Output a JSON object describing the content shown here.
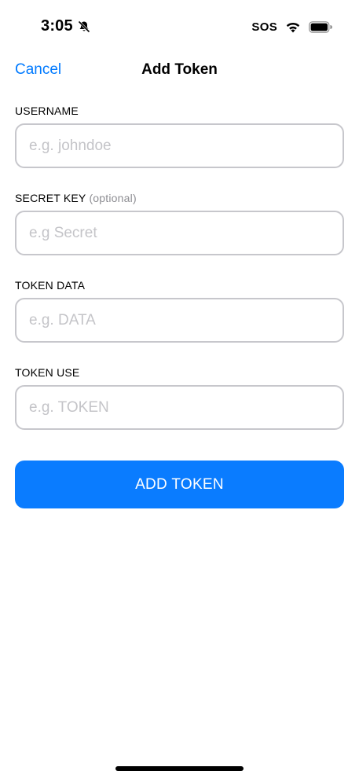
{
  "status_bar": {
    "time": "3:05",
    "carrier_text": "SOS",
    "icons": [
      "bell-slash-icon",
      "wifi-icon",
      "battery-icon"
    ]
  },
  "nav": {
    "cancel_label": "Cancel",
    "title": "Add Token"
  },
  "form": {
    "fields": [
      {
        "label": "USERNAME",
        "optional": "",
        "placeholder": "e.g. johndoe",
        "value": ""
      },
      {
        "label": "SECRET KEY",
        "optional": "(optional)",
        "placeholder": "e.g Secret",
        "value": ""
      },
      {
        "label": "TOKEN DATA",
        "optional": "",
        "placeholder": "e.g. DATA",
        "value": ""
      },
      {
        "label": "TOKEN USE",
        "optional": "",
        "placeholder": "e.g. TOKEN",
        "value": ""
      }
    ],
    "submit_label": "ADD TOKEN"
  },
  "colors": {
    "accent": "#0a7cff",
    "link": "#007aff",
    "field_border": "#c7c7cc",
    "placeholder": "#c4c4c8",
    "secondary_text": "#8e8e93"
  }
}
